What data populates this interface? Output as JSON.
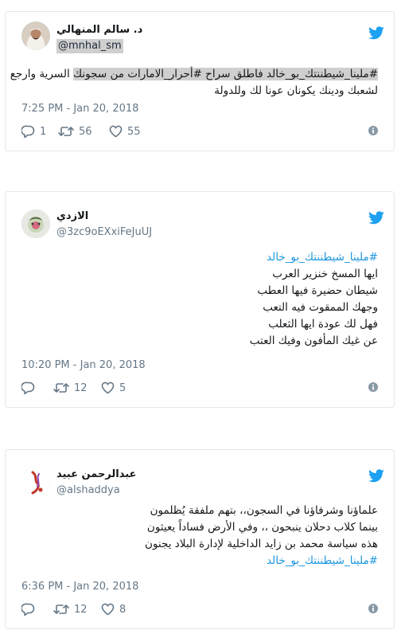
{
  "colors": {
    "accent": "#1da1f2",
    "hashtag": "#1b95e0",
    "muted": "#657786",
    "border": "#e1e8ed",
    "highlight": "#cfcfcf"
  },
  "icons": {
    "brand": "twitter-bird-icon",
    "reply": "reply-icon",
    "retweet": "retweet-icon",
    "like": "heart-icon",
    "info": "info-icon"
  },
  "tweets": [
    {
      "display_name": "د. سالم المنهالي",
      "handle": "@mnhal_sm",
      "body": {
        "l1_hl": "#ملينا_شيطننتك_بو_خالد فاطلق سراح #أحرار_الامارات من سجونك",
        "l1_rest": " السرية وارجع",
        "l2": "لشعبك ودينك يكونان عونا لك وللدولة"
      },
      "timestamp": "7:25 PM - Jan 20, 2018",
      "replies": "1",
      "retweets": "56",
      "likes": "55"
    },
    {
      "display_name": "الازدي",
      "handle": "@3zc9oEXxiFeJuUJ",
      "body": {
        "l1": "#ملينا_شيطننتك_بو_خالد",
        "l2": "ايها المسخ خنزير العرب",
        "l3": "شيطان حضيرة فيها العطب",
        "l4": "وجهك الممقوت فيه التعب",
        "l5": "فهل لك عودة ايها الثعلب",
        "l6": "عن غيك المأفون وفيك العتب"
      },
      "timestamp": "10:20 PM - Jan 20, 2018",
      "replies": "",
      "retweets": "12",
      "likes": "5"
    },
    {
      "display_name": "عبدالرحمن عبيد",
      "handle": "@alshaddya",
      "body": {
        "l1": "علماؤنا وشرفاؤنا في السجون،، بتهم ملفقة يُظلمون",
        "l2": "بينما كلاب دحلان ينبحون ،، وفي الأرض فساداً يعيثون",
        "l3": "هذه سياسة محمد بن زايد الداخلية لإدارة البلاد يجنون",
        "l4": "#ملينا_شيطننتك_بو_خالد"
      },
      "timestamp": "6:36 PM - Jan 20, 2018",
      "replies": "",
      "retweets": "12",
      "likes": "8"
    }
  ]
}
